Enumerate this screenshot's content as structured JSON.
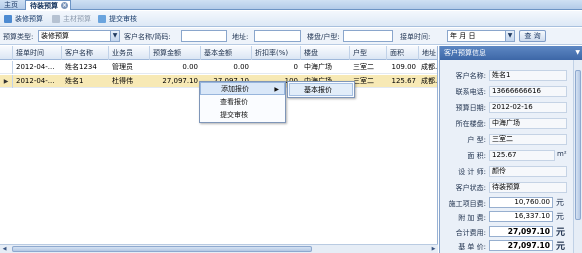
{
  "tabs": [
    {
      "label": "主页"
    },
    {
      "label": "待装预算"
    }
  ],
  "toolbar": {
    "renovation_budget": "装修预算",
    "main_material_budget": "主材预算",
    "submit_review": "提交审核"
  },
  "filter": {
    "budget_type_label": "预算类型:",
    "budget_type_value": "装修预算",
    "customer_label": "客户名称/简码:",
    "customer_value": "",
    "address_label": "地址:",
    "address_value": "",
    "building_label": "楼盘/户型:",
    "building_value": "",
    "date_label": "接单时间:",
    "date_value": "年  月  日",
    "query_button": "查 询"
  },
  "grid": {
    "columns": [
      "接单时间",
      "客户名称",
      "业务员",
      "预算金额",
      "基本金额",
      "折扣率(%)",
      "楼盘",
      "户型",
      "面积",
      "地址"
    ],
    "rows": [
      {
        "date": "2012-04-...",
        "customer": "姓名1234",
        "salesman": "管理员",
        "budget": "0.00",
        "base": "0.00",
        "discount": "0",
        "building": "中海广场",
        "house": "三室二",
        "area": "109.00",
        "addr": "成都..."
      },
      {
        "date": "2012-04-...",
        "customer": "姓名1",
        "salesman": "杜得伟",
        "budget": "27,097.10",
        "base": "27,097.10",
        "discount": "100",
        "building": "中海广场",
        "house": "三室二",
        "area": "125.67",
        "addr": "成都..."
      }
    ]
  },
  "context_menu": {
    "items": [
      "添加报价",
      "查看报价",
      "提交审核"
    ],
    "submenu": [
      "基本报价"
    ]
  },
  "panel": {
    "title": "客户预算信息",
    "fields": [
      {
        "label": "客户名称:",
        "value": "姓名1"
      },
      {
        "label": "联系电话:",
        "value": "13666666616"
      },
      {
        "label": "预算日期:",
        "value": "2012-02-16"
      },
      {
        "label": "所在楼盘:",
        "value": "中海广场"
      },
      {
        "label": "户  型:",
        "value": "三室二"
      },
      {
        "label": "面  积:",
        "value": "125.67"
      },
      {
        "label": "设 计 师:",
        "value": "颜伶"
      },
      {
        "label": "客户状态:",
        "value": "待装预算"
      }
    ],
    "money": [
      {
        "label": "施工项目费:",
        "value": "10,760.00",
        "unit": "元"
      },
      {
        "label": "附 加 费:",
        "value": "16,337.10",
        "unit": "元"
      },
      {
        "label": "合计费用:",
        "value": "27,097.10",
        "unit": "元"
      },
      {
        "label": "基 单 价:",
        "value": "27,097.10",
        "unit": "元"
      }
    ],
    "area_unit": "m²"
  },
  "colors": {
    "selected_row": "#f7e9b5",
    "panel_header": "#4a74b5",
    "accent_border": "#8aa6cc"
  }
}
